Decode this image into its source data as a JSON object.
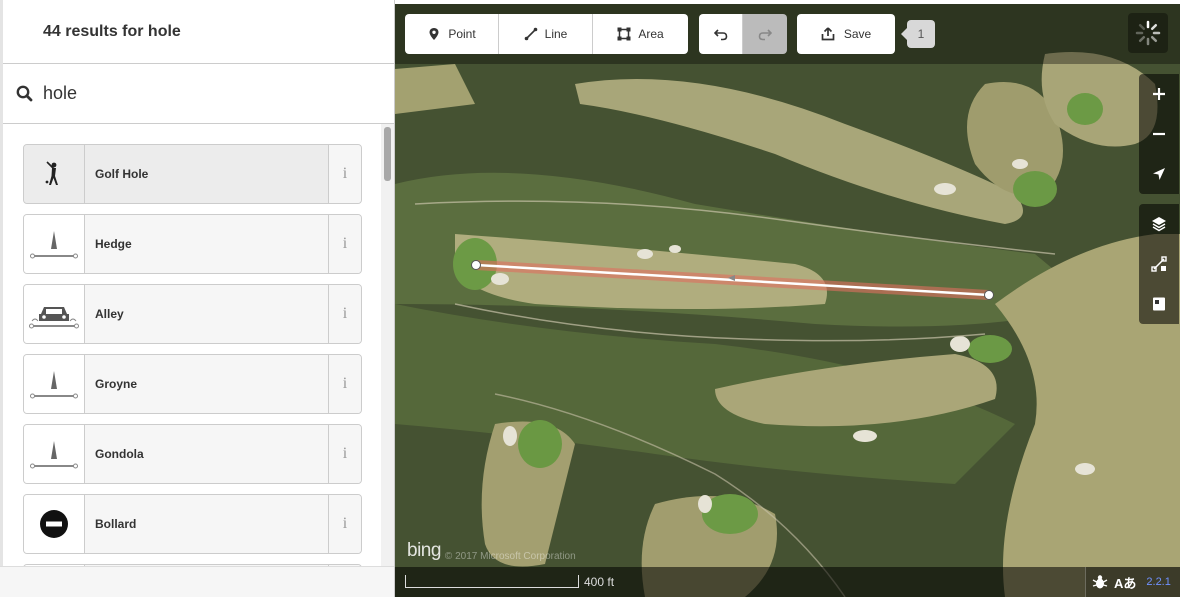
{
  "sidebar": {
    "results_title": "44 results for hole",
    "search": {
      "value": "hole",
      "placeholder": "Search"
    },
    "presets": [
      {
        "label": "Golf Hole",
        "icon": "golf-icon",
        "selected": true
      },
      {
        "label": "Hedge",
        "icon": "line-icon",
        "selected": false
      },
      {
        "label": "Alley",
        "icon": "car-icon",
        "selected": false
      },
      {
        "label": "Groyne",
        "icon": "line-icon",
        "selected": false
      },
      {
        "label": "Gondola",
        "icon": "line-icon",
        "selected": false
      },
      {
        "label": "Bollard",
        "icon": "bollard-icon",
        "selected": false
      }
    ],
    "info_glyph": "i"
  },
  "toolbar": {
    "point_label": "Point",
    "line_label": "Line",
    "area_label": "Area",
    "save_label": "Save",
    "save_count": "1"
  },
  "map": {
    "attribution_logo": "bing",
    "attribution_text": "© 2017 Microsoft Corporation",
    "scale_label": "400 ft",
    "issues_label": "Aあ",
    "version": "2.2.1",
    "drawn_line_color": "#ffffff",
    "highlight_color": "#e06e5f"
  }
}
